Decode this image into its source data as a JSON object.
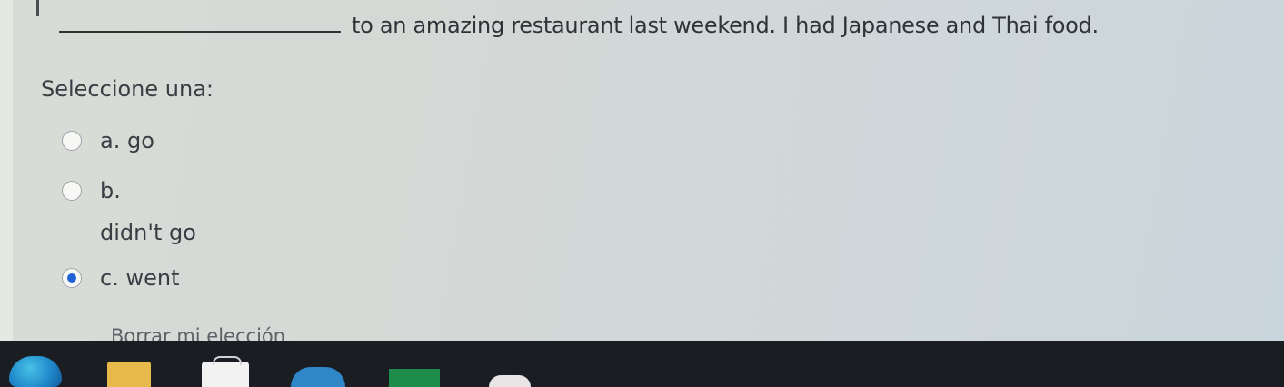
{
  "question": {
    "sentence": "to an amazing restaurant last weekend. I had Japanese and Thai food."
  },
  "prompt": "Seleccione una:",
  "options": [
    {
      "letter": "a.",
      "text": "go",
      "selected": false
    },
    {
      "letter": "b.",
      "text": "didn't go",
      "selected": false
    },
    {
      "letter": "c.",
      "text": "went",
      "selected": true
    }
  ],
  "clear_link": "Borrar mi elección",
  "taskbar": {
    "icons": [
      "edge-icon",
      "file-explorer-icon",
      "store-icon",
      "app-icon",
      "app-icon",
      "app-icon"
    ]
  },
  "colors": {
    "radio_selected": "#1f63d6",
    "taskbar": "#1a1d22"
  }
}
